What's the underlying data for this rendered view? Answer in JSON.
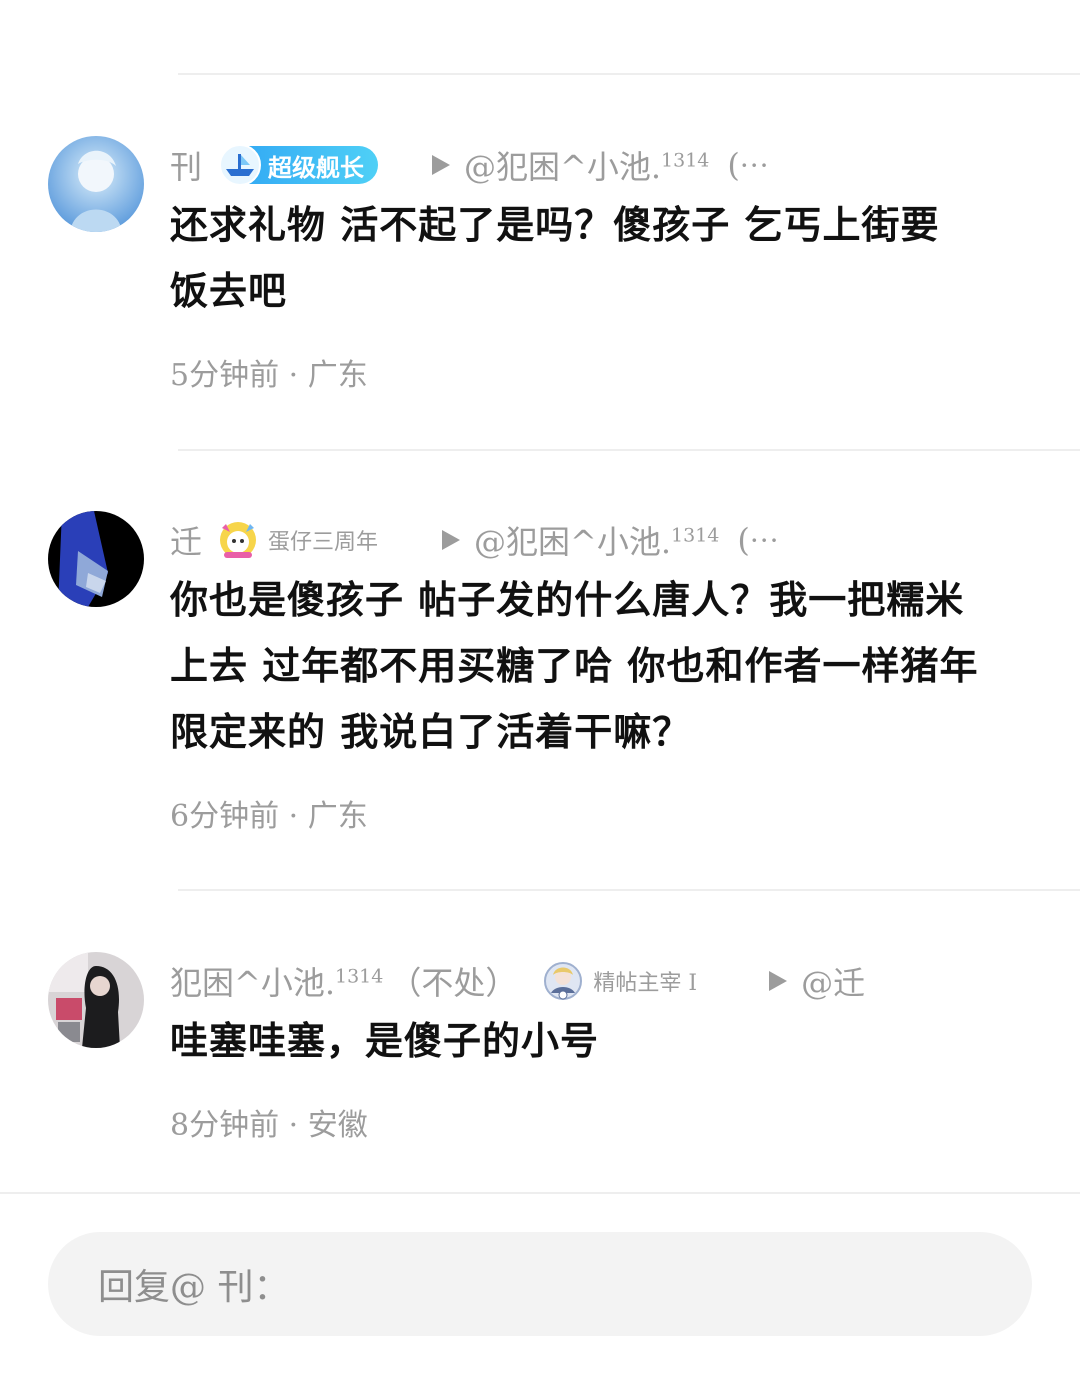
{
  "comments": [
    {
      "username": "刊",
      "badge": {
        "label": "超级舰长",
        "icon": "ship-badge-icon",
        "style": "pill"
      },
      "reply_to_name": "@犯困^小池.",
      "reply_to_sup": "1314",
      "more": "(",
      "ellipsis": "···",
      "text_line1": "还求礼物 活不起了是吗？傻孩子  乞丐上街要",
      "text_line2": "饭去吧",
      "time_location": "5分钟前 · 广东"
    },
    {
      "username": "迁",
      "badge": {
        "label": "蛋仔三周年",
        "icon": "eggy-badge-icon",
        "style": "plain"
      },
      "reply_to_name": "@犯困^小池.",
      "reply_to_sup": "1314",
      "more": "(",
      "ellipsis": "···",
      "text_line1": "你也是傻孩子 帖子发的什么唐人？我一把糯米",
      "text_line2": "上去 过年都不用买糖了哈 你也和作者一样猪年",
      "text_line3": "限定来的 我说白了活着干嘛？",
      "time_location": "6分钟前 · 广东"
    },
    {
      "username": "犯困^小池.",
      "username_sup": "1314",
      "username_suffix": "（不处）",
      "badge": {
        "label": "精帖主宰 I",
        "icon": "post-master-badge-icon",
        "style": "plain"
      },
      "reply_to_name": "@迁",
      "text_line1": "哇塞哇塞，是傻子的小号",
      "time_location": "8分钟前 · 安徽"
    }
  ],
  "reply_box": {
    "placeholder": "回复@ 刊："
  },
  "colors": {
    "badge_blue": "#2fa4f4",
    "meta_gray": "#9c9c9c",
    "text_black": "#111111"
  }
}
